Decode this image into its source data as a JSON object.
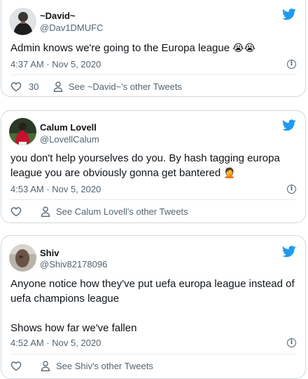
{
  "tweets": [
    {
      "name": "~David~",
      "handle": "@Dav1DMUFC",
      "text": "Admin knows we're going to the Europa league ",
      "emojis": "😭😭",
      "timestamp": "4:37 AM · Nov 5, 2020",
      "like_count": "30",
      "other_tweets": "See ~David~'s other Tweets"
    },
    {
      "name": "Calum Lovell",
      "handle": "@LovellCalum",
      "text": "you don't help yourselves do you. By hash tagging europa league you are obviously gonna get bantered ",
      "emojis": "🤦",
      "timestamp": "4:53 AM · Nov 5, 2020",
      "like_count": "",
      "other_tweets": "See Calum Lovell's other Tweets"
    },
    {
      "name": "Shiv",
      "handle": "@Shiv82178096",
      "text": "Anyone notice how they've put uefa europa league instead of uefa champions league\n\nShows how far we've fallen",
      "emojis": "",
      "timestamp": "4:52 AM · Nov 5, 2020",
      "like_count": "",
      "other_tweets": "See Shiv's other Tweets"
    }
  ],
  "icons": {
    "brand": "twitter-bird-icon",
    "info": "info-icon",
    "like": "heart-icon",
    "profile": "person-icon"
  },
  "colors": {
    "brand": "#1d9bf0",
    "text": "#0f1419",
    "secondary": "#536471",
    "border": "#cfd9de"
  }
}
